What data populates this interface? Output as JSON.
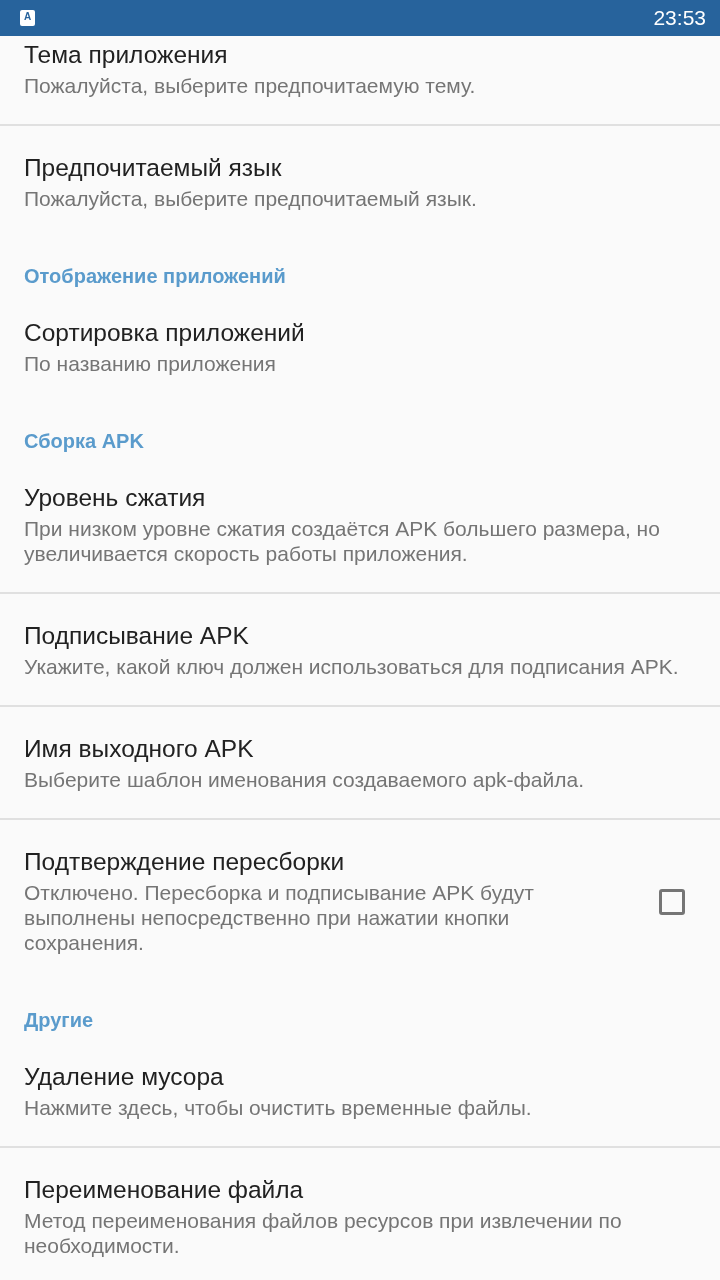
{
  "status_bar": {
    "app_icon_text": "A",
    "time": "23:53"
  },
  "sections": [
    {
      "items": [
        {
          "kind": "text",
          "title": "Тема приложения",
          "summary": "Пожалуйста, выберите предпочитаемую тему."
        },
        {
          "kind": "text",
          "title": "Предпочитаемый язык",
          "summary": "Пожалуйста, выберите предпочитаемый язык."
        }
      ]
    },
    {
      "header": "Отображение приложений",
      "items": [
        {
          "kind": "text",
          "title": "Сортировка приложений",
          "summary": "По названию приложения"
        }
      ]
    },
    {
      "header": "Сборка APK",
      "items": [
        {
          "kind": "text",
          "title": "Уровень сжатия",
          "summary": "При низком уровне сжатия создаётся APK большего размера, но увеличивается скорость работы приложения."
        },
        {
          "kind": "text",
          "title": "Подписывание APK",
          "summary": "Укажите, какой ключ должен использоваться для подписания APK."
        },
        {
          "kind": "text",
          "title": "Имя выходного APK",
          "summary": "Выберите шаблон именования создаваемого apk-файла."
        },
        {
          "kind": "checkbox",
          "title": "Подтверждение пересборки",
          "summary": "Отключено. Пересборка и подписывание APK будут выполнены непосредственно при нажатии кнопки сохранения.",
          "checked": false
        }
      ]
    },
    {
      "header": "Другие",
      "items": [
        {
          "kind": "text",
          "title": "Удаление мусора",
          "summary": "Нажмите здесь, чтобы очистить временные файлы."
        },
        {
          "kind": "text",
          "title": "Переименование файла",
          "summary": "Метод переименования файлов ресурсов при извлечении по необходимости."
        }
      ]
    }
  ]
}
